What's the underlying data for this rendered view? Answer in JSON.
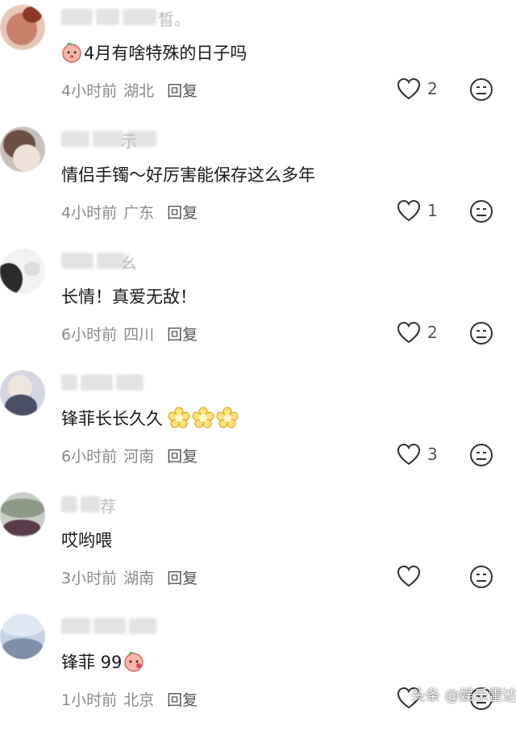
{
  "comments": [
    {
      "text": "4月有啥特殊的日子吗",
      "time": "4小时前",
      "location": "湖北",
      "reply": "回复",
      "likes": "2",
      "prefix_emoji": "peach-face-icon",
      "name_tail": "晳。"
    },
    {
      "text": "情侣手镯～好厉害能保存这么多年",
      "time": "4小时前",
      "location": "广东",
      "reply": "回复",
      "likes": "1",
      "name_tail": "⽰"
    },
    {
      "text": "长情！真爱无敌！",
      "time": "6小时前",
      "location": "四川",
      "reply": "回复",
      "likes": "2",
      "name_tail": "幺"
    },
    {
      "text": "锋菲长长久久",
      "time": "6小时前",
      "location": "河南",
      "reply": "回复",
      "likes": "3",
      "suffix_emoji": "flower-icon"
    },
    {
      "text": "哎哟喂",
      "time": "3小时前",
      "location": "湖南",
      "reply": "回复",
      "likes": "",
      "name_tail": "荐"
    },
    {
      "text": "锋菲 99",
      "time": "1小时前",
      "location": "北京",
      "reply": "回复",
      "likes": "",
      "suffix_emoji": "peach-face-icon"
    }
  ],
  "watermark": "头条 @娱乐雷达",
  "colors": {
    "text": "#1a1a1a",
    "meta": "#8a8a8a",
    "icon": "#333333"
  }
}
